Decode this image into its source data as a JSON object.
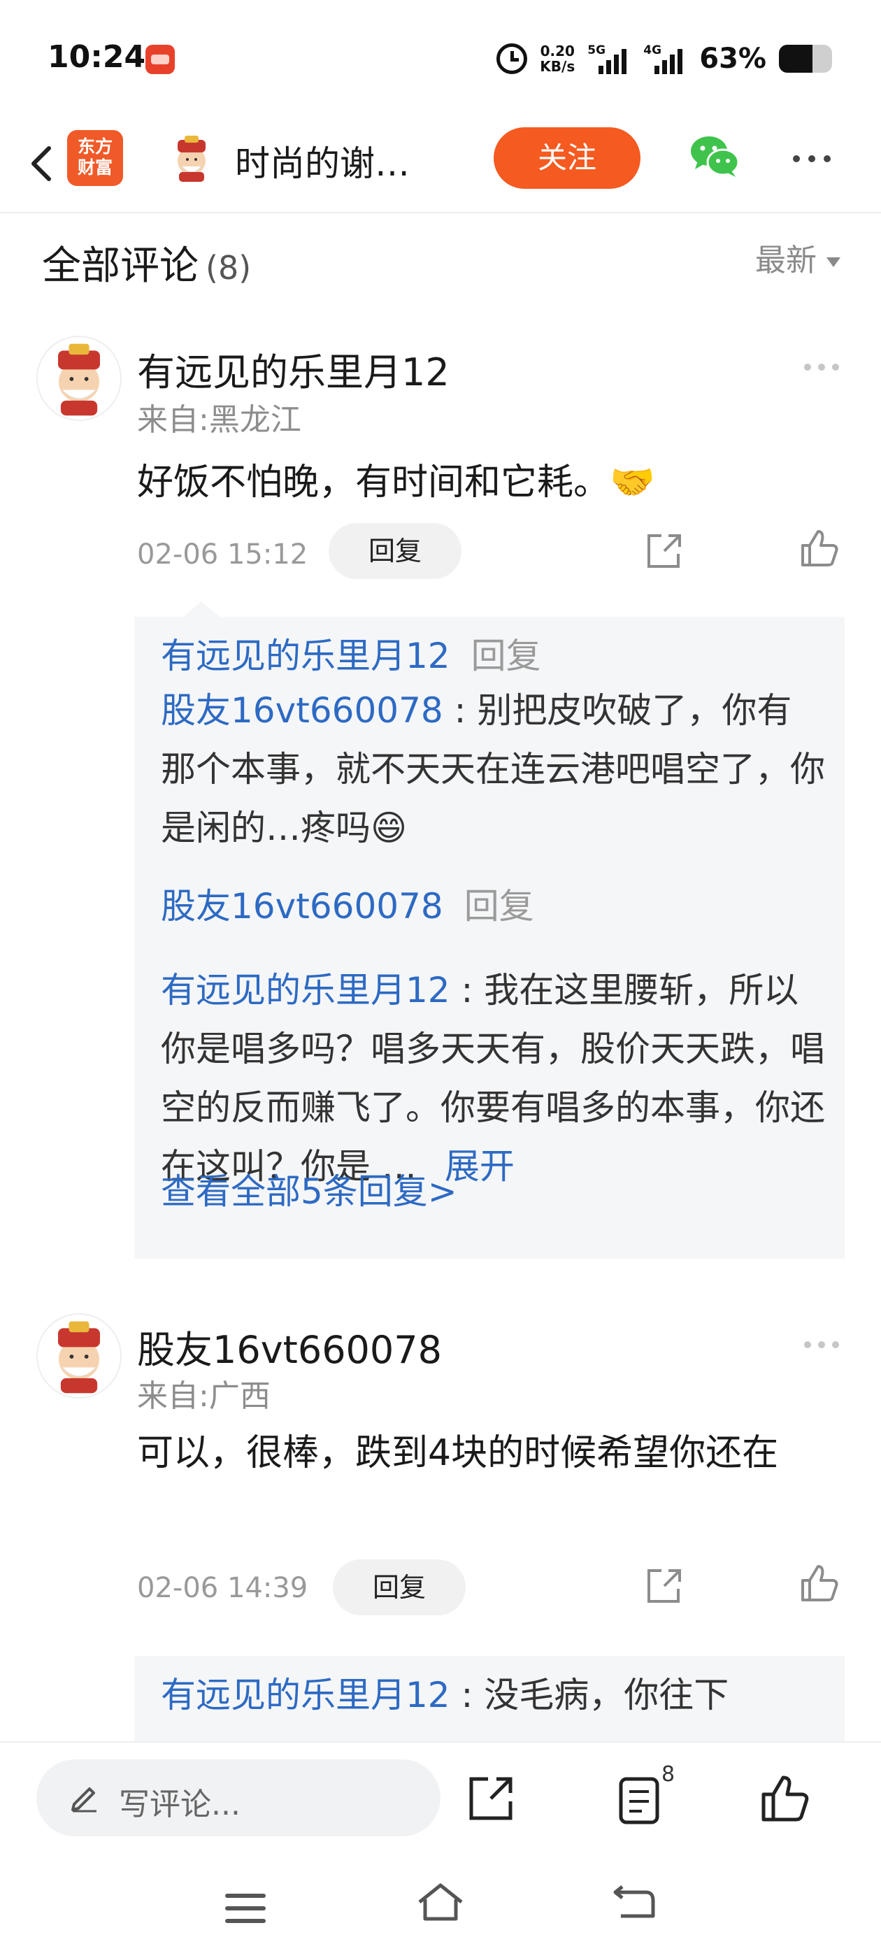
{
  "status_bar": {
    "time": "10:24",
    "net_speed_value": "0.20",
    "net_speed_unit": "KB/s",
    "signal1_tag": "5G",
    "signal2_tag": "4G",
    "battery_percent": "63%",
    "battery_level": 0.63,
    "icons": [
      "app-notification-icon",
      "alarm-icon",
      "signal-icon",
      "battery-icon"
    ]
  },
  "nav": {
    "logo_line1": "东方",
    "logo_line2": "财富",
    "title": "时尚的谢…",
    "follow_label": "关注",
    "icons": [
      "back-icon",
      "avatar",
      "wechat-icon",
      "more-icon"
    ]
  },
  "comments_header": {
    "title": "全部评论",
    "count": "(8)",
    "sort_label": "最新"
  },
  "comments": [
    {
      "name": "有远见的乐里月12",
      "location": "来自:黑龙江",
      "text": "好饭不怕晚，有时间和它耗。🤝",
      "time": "02-06 15:12",
      "reply_label": "回复",
      "replies": [
        {
          "author": "有远见的乐里月12",
          "tag": "回复",
          "target": "股友16vt660078",
          "text": "别把皮吹破了，你有那个本事，就不天天在连云港吧唱空了，你是闲的…疼吗😄"
        },
        {
          "author": "股友16vt660078",
          "tag": "回复",
          "target": "有远见的乐里月12",
          "text": "我在这里腰斩，所以你是唱多吗？唱多天天有，股价天天跌，唱空的反而赚飞了。你要有唱多的本事，你还在这叫？你是 …",
          "expand": "展开"
        }
      ],
      "view_all": "查看全部5条回复>"
    },
    {
      "name": "股友16vt660078",
      "location": "来自:广西",
      "text": "可以，很棒，跌到4块的时候希望你还在",
      "time": "02-06 14:39",
      "reply_label": "回复",
      "replies": [
        {
          "target": "有远见的乐里月12",
          "text": "没毛病，你往下"
        }
      ]
    }
  ],
  "bottom_bar": {
    "write_placeholder": "写评论...",
    "comment_count_badge": "8",
    "icons": [
      "pencil-icon",
      "share-icon",
      "comments-list-icon",
      "like-icon"
    ]
  },
  "system_nav": {
    "icons": [
      "menu-icon",
      "home-icon",
      "back-icon"
    ]
  },
  "colors": {
    "accent": "#f55a21",
    "link_blue": "#2d6ac3",
    "reply_bg": "#f5f6f8"
  }
}
